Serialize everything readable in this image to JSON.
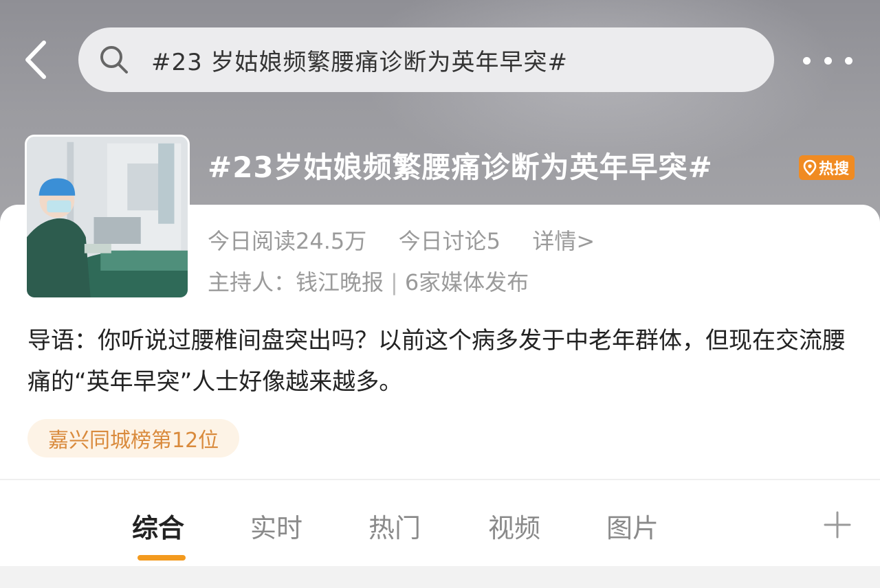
{
  "header": {
    "back_icon": "chevron-left-icon",
    "search_icon": "search-icon",
    "search_text": "#23 岁姑娘频繁腰痛诊断为英年早突#",
    "more_icon": "more-dots-icon"
  },
  "topic": {
    "title": "#23岁姑娘频繁腰痛诊断为英年早突#",
    "hot_badge": "热搜",
    "hot_badge_icon": "location-pin-icon",
    "thumbnail_icon": "surgery-photo"
  },
  "stats": {
    "today_reads": "今日阅读24.5万",
    "today_discussions": "今日讨论5",
    "details_link": "详情>",
    "host_label": "主持人：",
    "host_name": "钱江晚报",
    "media_count": "6家媒体发布"
  },
  "intro": {
    "text": "导语：你听说过腰椎间盘突出吗？以前这个病多发于中老年群体，但现在交流腰痛的“英年早突”人士好像越来越多。"
  },
  "rank_tag": {
    "label": "嘉兴同城榜第12位"
  },
  "tabs": {
    "items": [
      {
        "label": "综合",
        "active": true
      },
      {
        "label": "实时",
        "active": false
      },
      {
        "label": "热门",
        "active": false
      },
      {
        "label": "视频",
        "active": false
      },
      {
        "label": "图片",
        "active": false
      }
    ],
    "add_icon": "plus-icon"
  },
  "colors": {
    "accent": "#f39a1e",
    "hot_badge": "#f08b22",
    "rank_tag_bg": "#fdf3e6",
    "rank_tag_text": "#d98a3c"
  }
}
